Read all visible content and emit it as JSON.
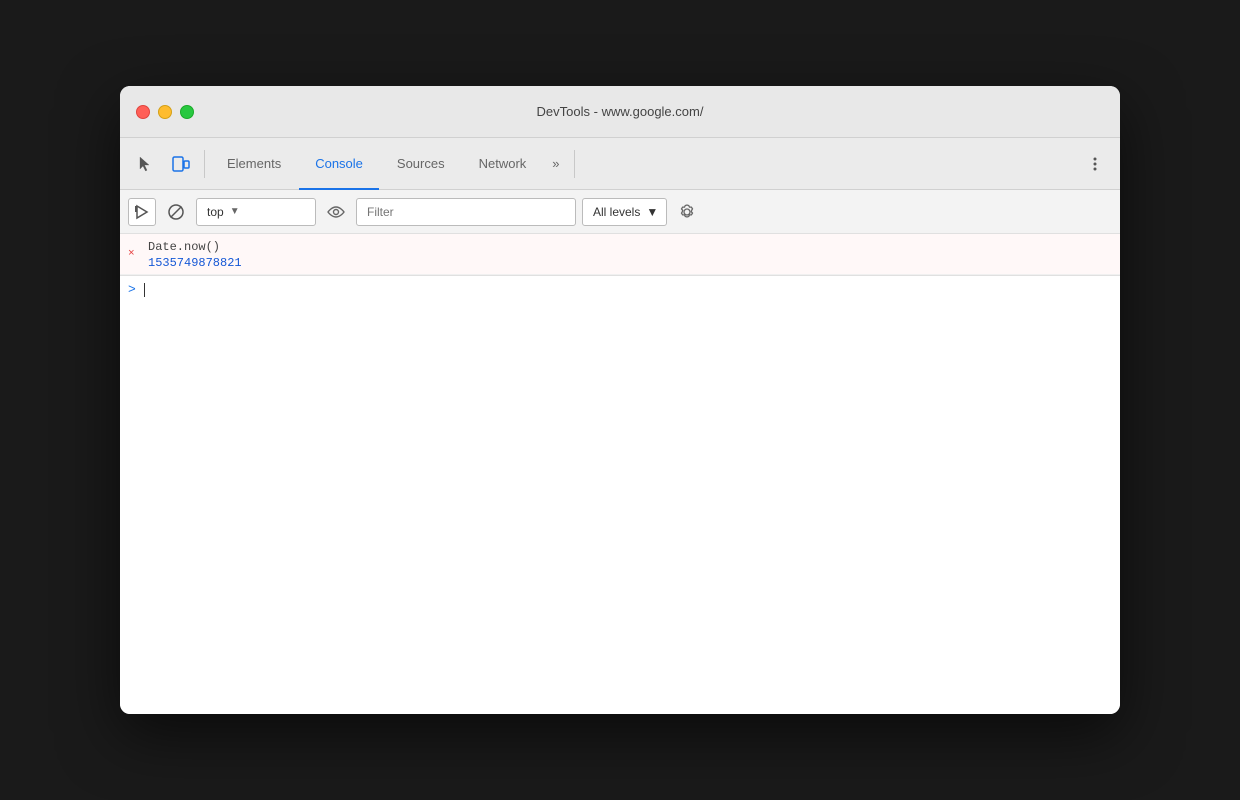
{
  "window": {
    "title": "DevTools - www.google.com/"
  },
  "traffic_lights": {
    "close_label": "close",
    "minimize_label": "minimize",
    "maximize_label": "maximize"
  },
  "tabs": [
    {
      "id": "elements",
      "label": "Elements",
      "active": false
    },
    {
      "id": "console",
      "label": "Console",
      "active": true
    },
    {
      "id": "sources",
      "label": "Sources",
      "active": false
    },
    {
      "id": "network",
      "label": "Network",
      "active": false
    },
    {
      "id": "more",
      "label": "»",
      "active": false
    }
  ],
  "console_toolbar": {
    "context_value": "top",
    "context_arrow": "▼",
    "filter_placeholder": "Filter",
    "levels_label": "All levels",
    "levels_arrow": "▼"
  },
  "console_entries": [
    {
      "type": "error",
      "icon": "×",
      "text": "Date.now()",
      "result": "1535749878821"
    }
  ],
  "console_input": {
    "prompt": ">"
  },
  "colors": {
    "active_tab": "#1a73e8",
    "result_text": "#1558d6",
    "error_icon": "#e53e3e",
    "prompt": "#1a73e8"
  }
}
